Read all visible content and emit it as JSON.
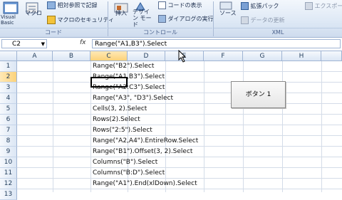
{
  "ribbon": {
    "visual_basic": "Visual Basic",
    "macro": "マクロ",
    "relative_ref": "相対参照で記録",
    "macro_security": "マクロのセキュリティ",
    "group_code": "コード",
    "insert": "挿入",
    "design_mode": "デザイン モード",
    "view_code": "コードの表示",
    "run_dialog": "ダイアログの実行",
    "group_control": "コントロール",
    "source": "ソース",
    "expansion_pack": "拡張パック",
    "refresh_data": "データの更新",
    "export": "エクスポー",
    "group_xml": "XML"
  },
  "formula_bar": {
    "name_box": "C2",
    "fx": "fx",
    "formula": "Range(\"A1,B3\").Select"
  },
  "columns": [
    "A",
    "B",
    "C",
    "D",
    "E",
    "F",
    "G",
    "H"
  ],
  "rows": [
    "1",
    "2",
    "3",
    "4",
    "5",
    "6",
    "7",
    "8",
    "9",
    "10",
    "11",
    "12",
    "13"
  ],
  "cells": [
    "Range(\"B2\").Select",
    "Range(\"A1,B3\").Select",
    "Range(\"A2:C3\").Select",
    "Range(\"A3\", \"D3\").Select",
    "Cells(3, 2).Select",
    "Rows(2).Select",
    "Rows(\"2:5\").Select",
    "Range(\"A2,A4\").EntireRow.Select",
    "Range(\"B1\").Offset(3, 2).Select",
    "Columns(\"B\").Select",
    "Columns(\"B:D\").Select",
    "Range(\"A1\").End(xlDown).Select"
  ],
  "button": {
    "label": "ボタン 1"
  }
}
